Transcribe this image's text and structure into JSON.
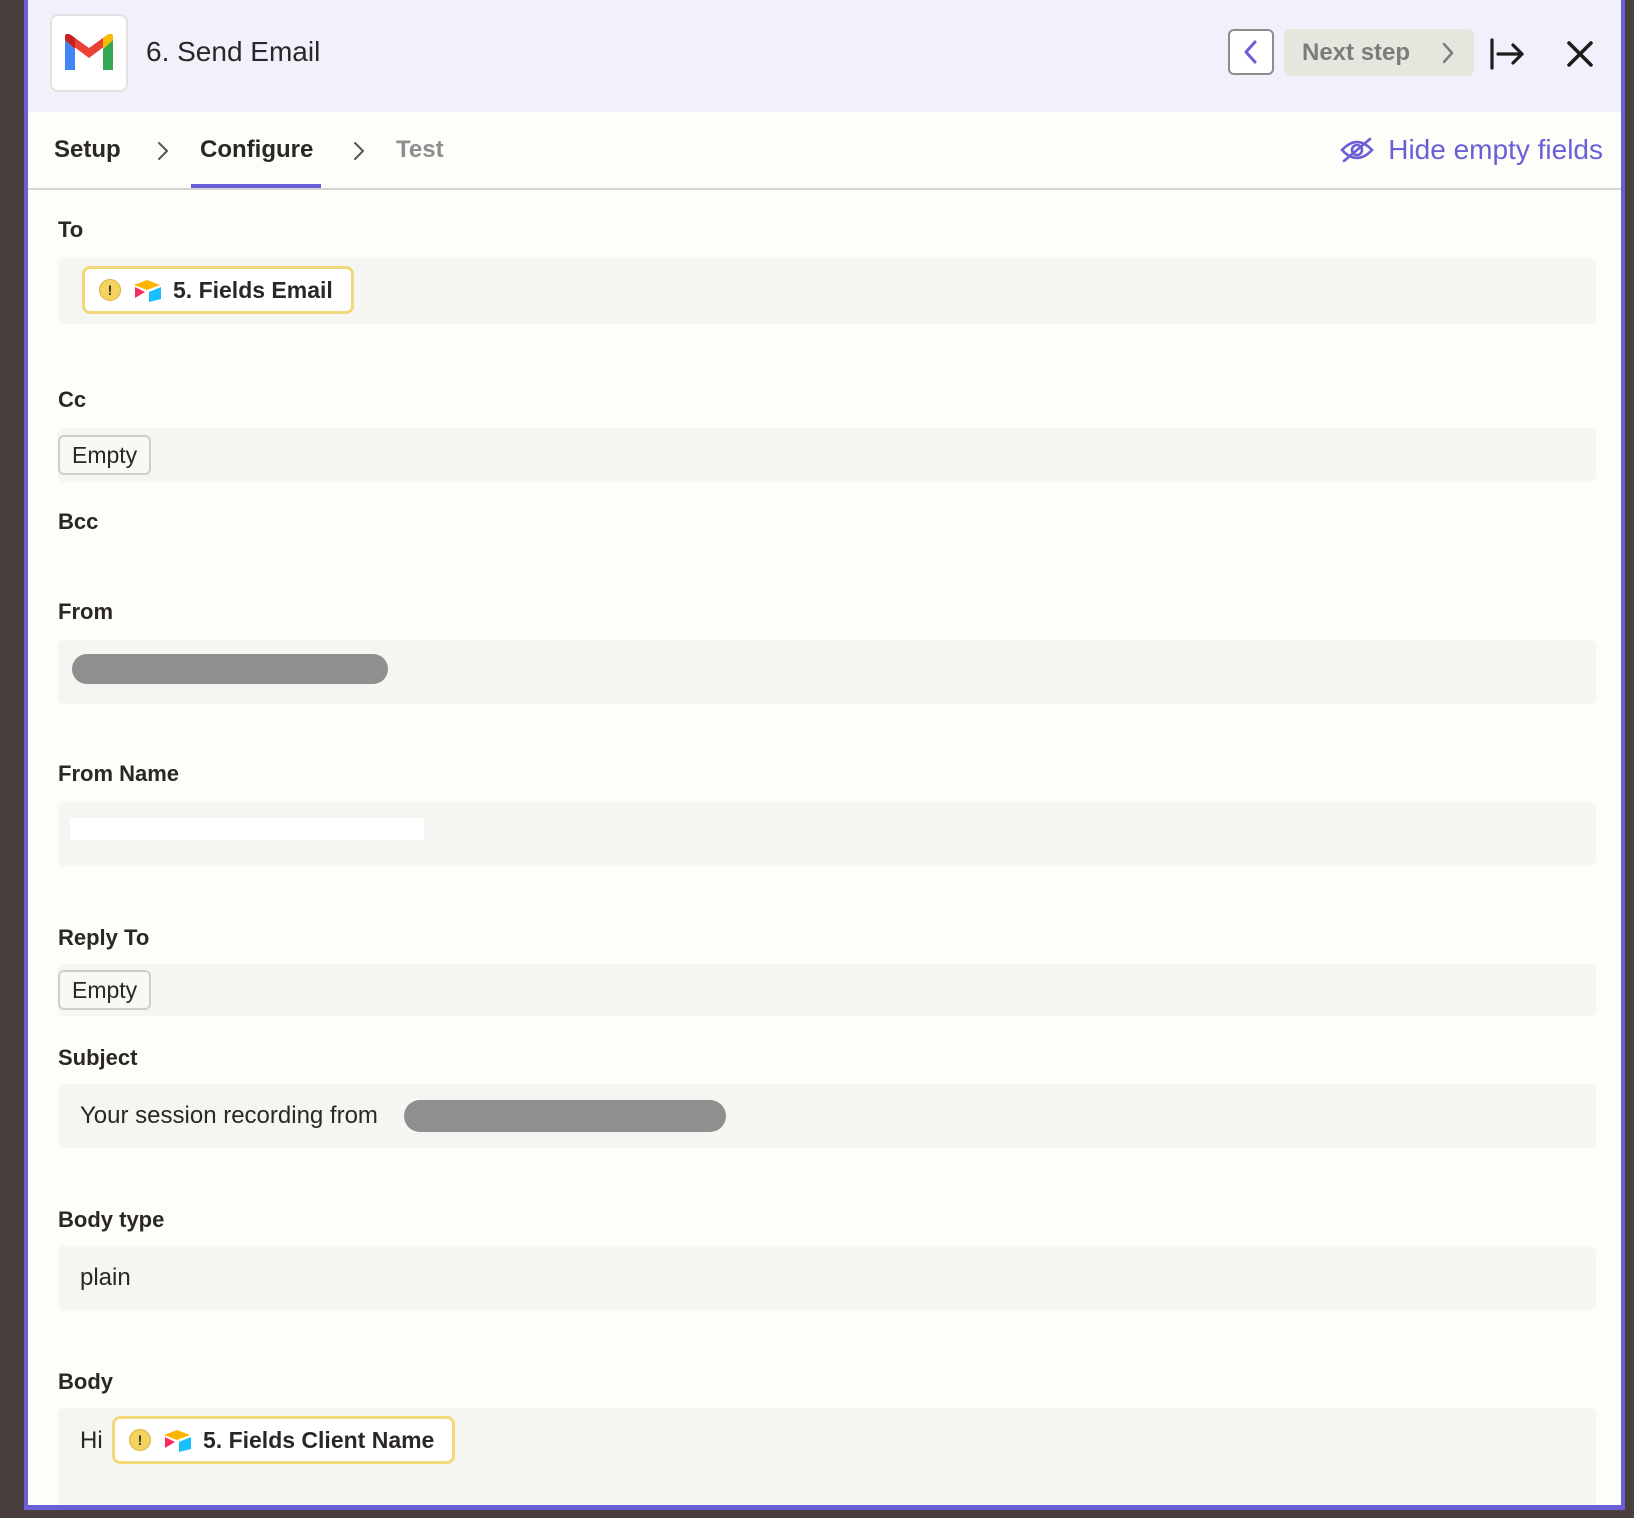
{
  "header": {
    "step_title": "6. Send Email",
    "prev_icon": "chevron-left-icon",
    "next_label": "Next step",
    "expand_icon": "arrow-to-right-icon",
    "close_icon": "close-icon",
    "app_icon": "gmail-icon"
  },
  "tabs": {
    "setup": "Setup",
    "configure": "Configure",
    "test": "Test",
    "active": "Configure"
  },
  "toolbar": {
    "hide_empty_label": "Hide empty fields",
    "hide_empty_icon": "eye-off-icon"
  },
  "fields": {
    "to": {
      "label": "To",
      "token_label": "5. Fields Email"
    },
    "cc": {
      "label": "Cc",
      "value": "Empty"
    },
    "bcc": {
      "label": "Bcc"
    },
    "from": {
      "label": "From"
    },
    "from_name": {
      "label": "From Name"
    },
    "reply_to": {
      "label": "Reply To",
      "value": "Empty"
    },
    "subject": {
      "label": "Subject",
      "value_prefix": "Your session recording from"
    },
    "body_type": {
      "label": "Body type",
      "value": "plain"
    },
    "body": {
      "label": "Body",
      "prefix": "Hi",
      "token_label": "5. Fields Client Name"
    }
  },
  "colors": {
    "accent": "#6a5fd6",
    "token_border": "#f1d97a",
    "warning": "#f4d35e",
    "header_bg": "#f1f1fb",
    "panel_bg": "#fdfdf9",
    "field_bg": "#f5f5f1"
  }
}
